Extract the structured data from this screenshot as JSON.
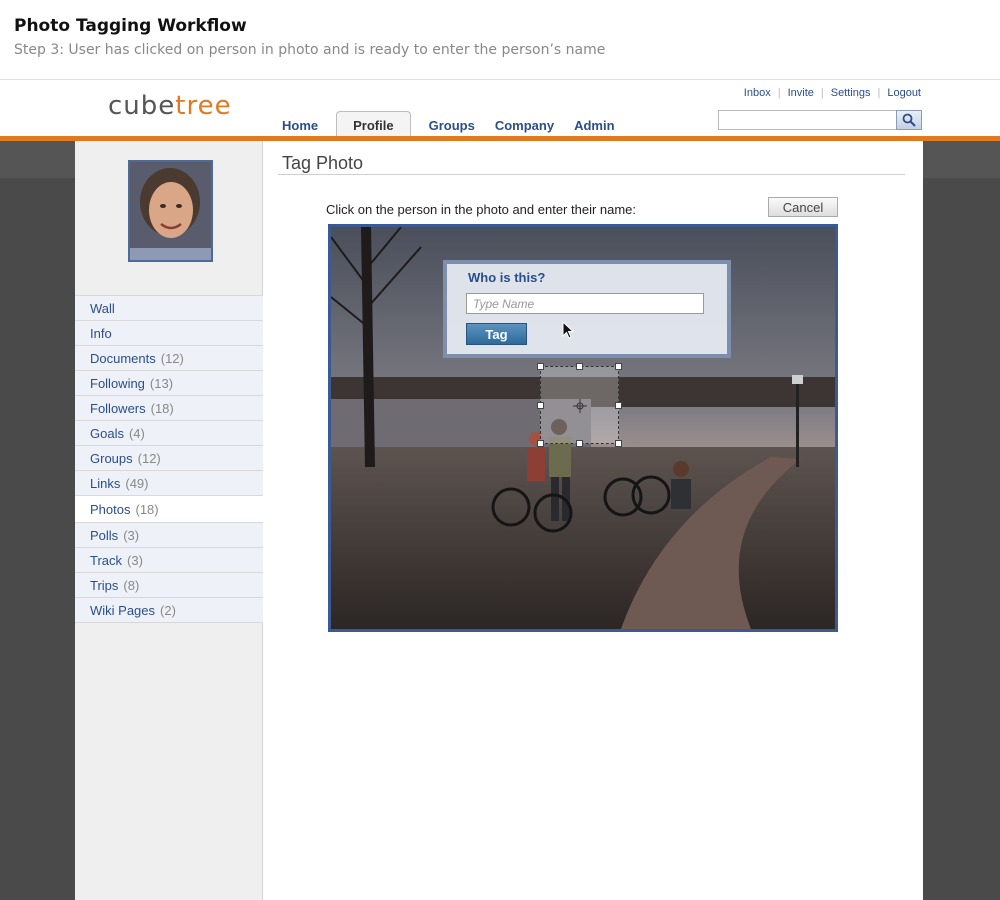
{
  "workflow": {
    "title": "Photo Tagging Workflow",
    "step": "Step 3: User has clicked on person in photo and is ready to enter the person’s name"
  },
  "brand": {
    "part1": "cube",
    "part2": "tree",
    "accent": "#e07a20"
  },
  "utility_links": [
    "Inbox",
    "Invite",
    "Settings",
    "Logout"
  ],
  "nav": {
    "tabs": [
      {
        "label": "Home"
      },
      {
        "label": "Profile",
        "active": true
      },
      {
        "label": "Groups"
      },
      {
        "label": "Company"
      },
      {
        "label": "Admin"
      }
    ],
    "search_value": ""
  },
  "sidebar": {
    "items": [
      {
        "label": "Wall",
        "count": ""
      },
      {
        "label": "Info",
        "count": ""
      },
      {
        "label": "Documents",
        "count": "(12)"
      },
      {
        "label": "Following",
        "count": "(13)"
      },
      {
        "label": "Followers",
        "count": "(18)"
      },
      {
        "label": "Goals",
        "count": "(4)"
      },
      {
        "label": "Groups",
        "count": "(12)"
      },
      {
        "label": "Links",
        "count": "(49)"
      },
      {
        "label": "Photos",
        "count": "(18)",
        "active": true
      },
      {
        "label": "Polls",
        "count": "(3)"
      },
      {
        "label": "Track",
        "count": "(3)"
      },
      {
        "label": "Trips",
        "count": "(8)"
      },
      {
        "label": "Wiki Pages",
        "count": "(2)"
      }
    ]
  },
  "main": {
    "title": "Tag Photo",
    "instruction": "Click on the person in the photo and enter their name:",
    "cancel_label": "Cancel"
  },
  "tag_dialog": {
    "question": "Who is this?",
    "placeholder": "Type Name",
    "button_label": "Tag"
  }
}
